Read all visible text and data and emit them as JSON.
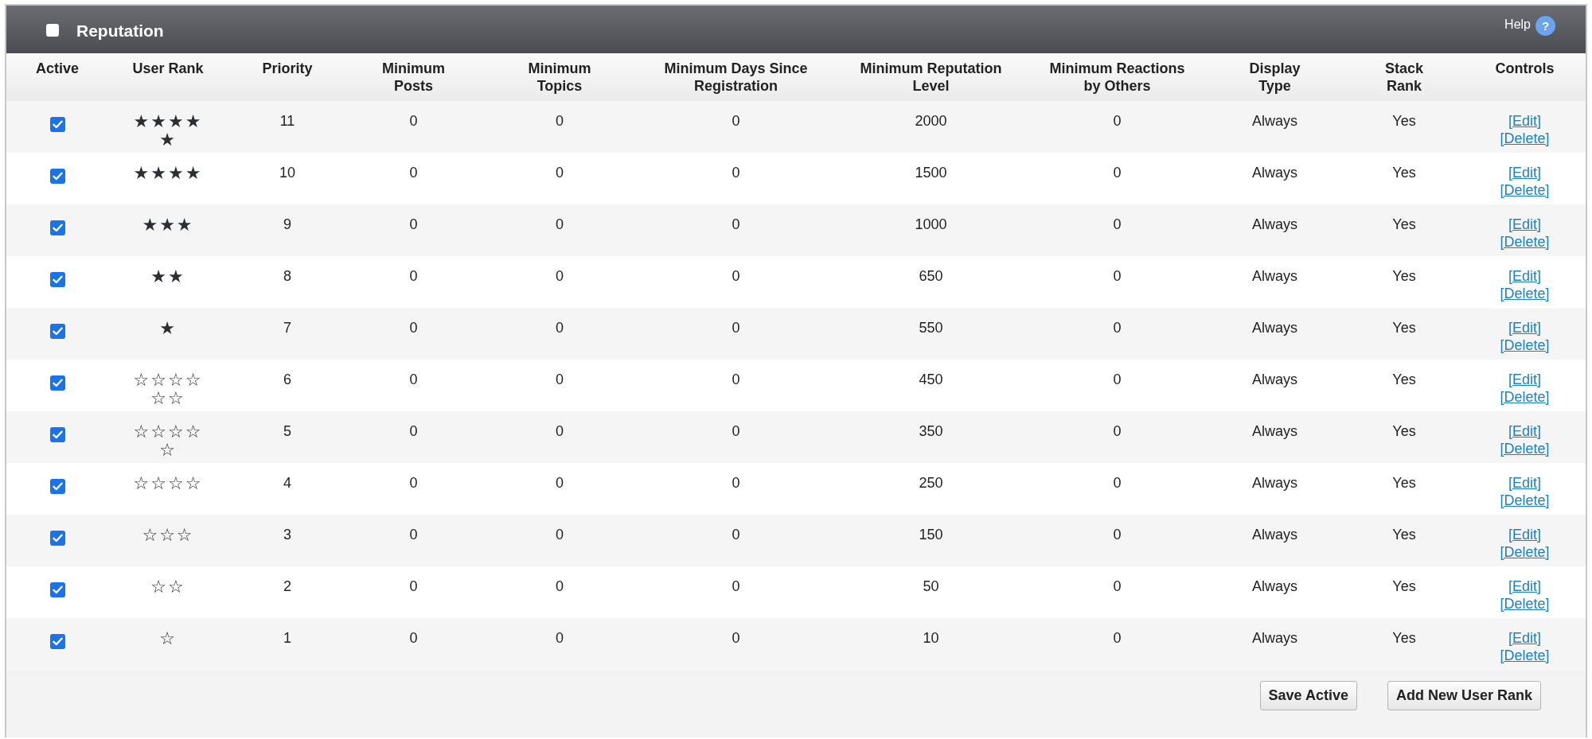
{
  "panel": {
    "title": "Reputation",
    "select_all": {
      "checked": false
    },
    "help": "Help",
    "help_icon": "?"
  },
  "columns": [
    "Active",
    "User Rank",
    "Priority",
    "Minimum Posts",
    "Minimum Topics",
    "Minimum Days Since Registration",
    "Minimum Reputation Level",
    "Minimum Reactions by Others",
    "Display Type",
    "Stack Rank",
    "Controls"
  ],
  "rows": [
    {
      "active": true,
      "rank": "★★★★★",
      "priority": "11",
      "min_posts": "0",
      "min_topics": "0",
      "min_days": "0",
      "min_reputation": "2000",
      "min_reactions": "0",
      "display_type": "Always",
      "stack_rank": "Yes",
      "edit": "[Edit]",
      "delete": "[Delete]"
    },
    {
      "active": true,
      "rank": "★★★★",
      "priority": "10",
      "min_posts": "0",
      "min_topics": "0",
      "min_days": "0",
      "min_reputation": "1500",
      "min_reactions": "0",
      "display_type": "Always",
      "stack_rank": "Yes",
      "edit": "[Edit]",
      "delete": "[Delete]"
    },
    {
      "active": true,
      "rank": "★★★",
      "priority": "9",
      "min_posts": "0",
      "min_topics": "0",
      "min_days": "0",
      "min_reputation": "1000",
      "min_reactions": "0",
      "display_type": "Always",
      "stack_rank": "Yes",
      "edit": "[Edit]",
      "delete": "[Delete]"
    },
    {
      "active": true,
      "rank": "★★",
      "priority": "8",
      "min_posts": "0",
      "min_topics": "0",
      "min_days": "0",
      "min_reputation": "650",
      "min_reactions": "0",
      "display_type": "Always",
      "stack_rank": "Yes",
      "edit": "[Edit]",
      "delete": "[Delete]"
    },
    {
      "active": true,
      "rank": "★",
      "priority": "7",
      "min_posts": "0",
      "min_topics": "0",
      "min_days": "0",
      "min_reputation": "550",
      "min_reactions": "0",
      "display_type": "Always",
      "stack_rank": "Yes",
      "edit": "[Edit]",
      "delete": "[Delete]"
    },
    {
      "active": true,
      "rank": "☆☆☆☆☆☆",
      "priority": "6",
      "min_posts": "0",
      "min_topics": "0",
      "min_days": "0",
      "min_reputation": "450",
      "min_reactions": "0",
      "display_type": "Always",
      "stack_rank": "Yes",
      "edit": "[Edit]",
      "delete": "[Delete]"
    },
    {
      "active": true,
      "rank": "☆☆☆☆☆",
      "priority": "5",
      "min_posts": "0",
      "min_topics": "0",
      "min_days": "0",
      "min_reputation": "350",
      "min_reactions": "0",
      "display_type": "Always",
      "stack_rank": "Yes",
      "edit": "[Edit]",
      "delete": "[Delete]"
    },
    {
      "active": true,
      "rank": "☆☆☆☆",
      "priority": "4",
      "min_posts": "0",
      "min_topics": "0",
      "min_days": "0",
      "min_reputation": "250",
      "min_reactions": "0",
      "display_type": "Always",
      "stack_rank": "Yes",
      "edit": "[Edit]",
      "delete": "[Delete]"
    },
    {
      "active": true,
      "rank": "☆☆☆",
      "priority": "3",
      "min_posts": "0",
      "min_topics": "0",
      "min_days": "0",
      "min_reputation": "150",
      "min_reactions": "0",
      "display_type": "Always",
      "stack_rank": "Yes",
      "edit": "[Edit]",
      "delete": "[Delete]"
    },
    {
      "active": true,
      "rank": "☆☆",
      "priority": "2",
      "min_posts": "0",
      "min_topics": "0",
      "min_days": "0",
      "min_reputation": "50",
      "min_reactions": "0",
      "display_type": "Always",
      "stack_rank": "Yes",
      "edit": "[Edit]",
      "delete": "[Delete]"
    },
    {
      "active": true,
      "rank": "☆",
      "priority": "1",
      "min_posts": "0",
      "min_topics": "0",
      "min_days": "0",
      "min_reputation": "10",
      "min_reactions": "0",
      "display_type": "Always",
      "stack_rank": "Yes",
      "edit": "[Edit]",
      "delete": "[Delete]"
    }
  ],
  "buttons": [
    "Save Active",
    "Add New User Rank"
  ]
}
